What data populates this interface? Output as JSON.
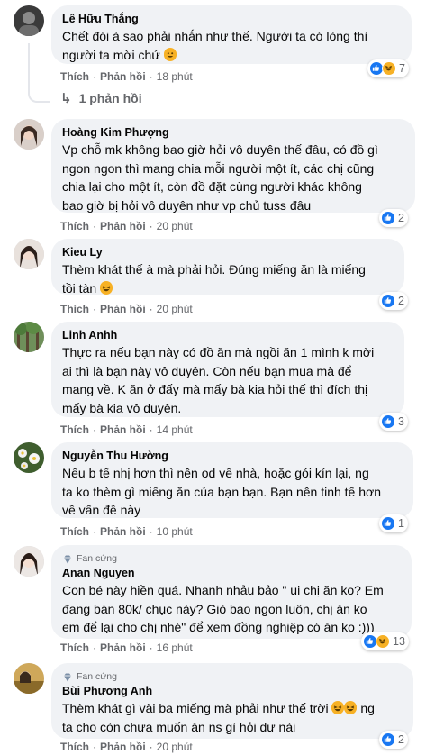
{
  "comments": [
    {
      "name": "Lê Hữu Thắng",
      "text": "Chết đói à sao phải nhắn như thế. Người ta có lòng thì\nngười ta mời chứ",
      "emoji": "smile",
      "reaction_count": "7",
      "like_label": "Thích",
      "reply_label": "Phản hồi",
      "time": "18 phút",
      "replies_label": "1 phản hồi"
    },
    {
      "name": "Hoàng Kim Phượng",
      "text": "Vp chỗ mk không bao giờ hỏi vô duyên thế đâu, có đồ gì\nngon ngon thì mang chia mỗi người một ít, các chị cũng\nchia lại cho một ít, còn đồ đặt cùng người khác không\nbao giờ bị hỏi vô duyên như vp chủ tuss đâu",
      "reaction_count": "2",
      "like_label": "Thích",
      "reply_label": "Phản hồi",
      "time": "20 phút"
    },
    {
      "name": "Kieu Ly",
      "text": "Thèm khát thế à mà phải hỏi. Đúng miếng ăn là miếng\ntồi tàn",
      "emoji": "laugh",
      "reaction_count": "2",
      "like_label": "Thích",
      "reply_label": "Phản hồi",
      "time": "20 phút"
    },
    {
      "name": "Linh Anhh",
      "text": "Thực ra nếu bạn này có đồ ăn mà ngồi ăn 1 mình k mời\nai thì là bạn này vô duyên. Còn nếu bạn mua mà để\nmang về. K ăn ở đấy mà mấy bà kia hỏi thế thì đích thị\nmấy bà kia vô duyên.",
      "reaction_count": "3",
      "like_label": "Thích",
      "reply_label": "Phản hồi",
      "time": "14 phút"
    },
    {
      "name": "Nguyễn Thu Hường",
      "text": "Nếu b tế nhị hơn thì nên od về nhà, hoặc gói kín lại, ng\nta ko thèm gì miếng ăn của bạn bạn. Bạn nên tinh tế hơn\nvề vấn đề này",
      "reaction_count": "1",
      "like_label": "Thích",
      "reply_label": "Phản hồi",
      "time": "10 phút"
    },
    {
      "badge": "Fan cứng",
      "name": "Anan Nguyen",
      "text": "Con bé này hiền quá. Nhanh nhảu bảo \" ui chị ăn ko? Em\nđang bán 80k/ chục này? Giò bao ngon luôn, chị ăn ko\nem để lại cho chị nhé\" để xem đồng nghiệp có ăn ko :)))",
      "reaction_count": "13",
      "like_label": "Thích",
      "reply_label": "Phản hồi",
      "time": "16 phút"
    },
    {
      "badge": "Fan cứng",
      "name": "Bùi Phương Anh",
      "text_before": "Thèm khát gì vài ba miếng mà phải như thế trời",
      "text_after": "ng\nta cho còn chưa muốn ăn ns gì hỏi dư nài",
      "reaction_count": "2",
      "like_label": "Thích",
      "reply_label": "Phản hồi",
      "time": "20 phút"
    }
  ],
  "colors": {
    "bubble": "#f0f2f5",
    "meta": "#65676b",
    "like": "#1877f2",
    "haha": "#f7b125"
  }
}
